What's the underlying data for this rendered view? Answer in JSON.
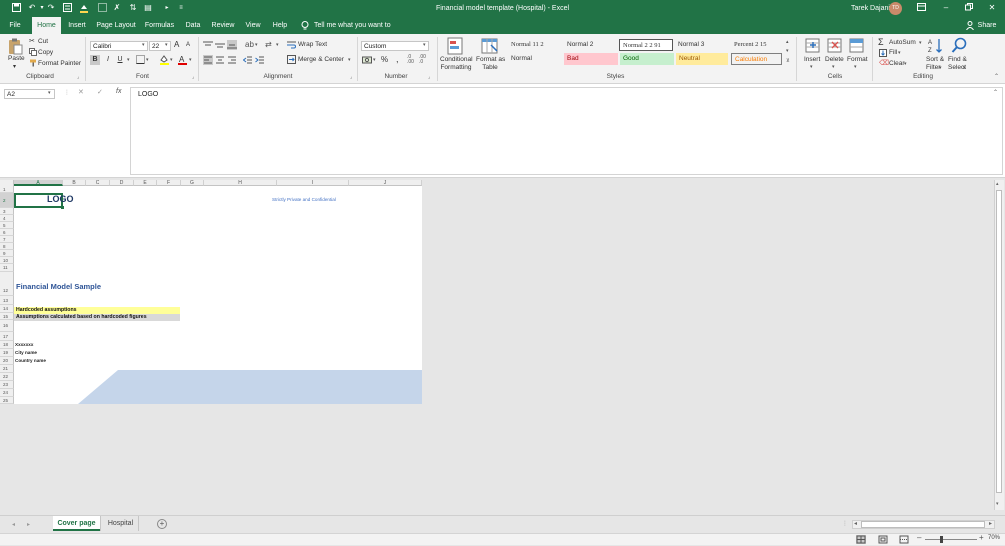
{
  "titlebar": {
    "title": "Financial model template (Hospital)  -  Excel",
    "user": "Tarek Dajani",
    "avatar_initials": "TD"
  },
  "ribbon_tabs": [
    "File",
    "Home",
    "Insert",
    "Page Layout",
    "Formulas",
    "Data",
    "Review",
    "View",
    "Help"
  ],
  "tell_me": "Tell me what you want to do",
  "share_label": "Share",
  "clipboard": {
    "paste": "Paste",
    "cut": "Cut",
    "copy": "Copy",
    "format_painter": "Format Painter",
    "label": "Clipboard"
  },
  "font": {
    "name": "Calibri",
    "size": "22",
    "bold": "B",
    "italic": "I",
    "underline": "U",
    "label": "Font"
  },
  "alignment": {
    "wrap_text": "Wrap Text",
    "merge_center": "Merge & Center",
    "label": "Alignment"
  },
  "number": {
    "format": "Custom",
    "percent": "%",
    "comma": ",",
    "label": "Number"
  },
  "styles": {
    "conditional_formatting": [
      "Conditional",
      "Formatting"
    ],
    "format_as_table": [
      "Format as",
      "Table"
    ],
    "gallery": [
      {
        "name": "Normal 11 2"
      },
      {
        "name": "Normal 2"
      },
      {
        "name": "Normal 2 2 91"
      },
      {
        "name": "Normal 3"
      },
      {
        "name": "Percent 2 15"
      },
      {
        "name": "Normal"
      },
      {
        "name": "Bad"
      },
      {
        "name": "Good"
      },
      {
        "name": "Neutral"
      },
      {
        "name": "Calculation"
      }
    ],
    "label": "Styles"
  },
  "cells": {
    "insert": "Insert",
    "delete": "Delete",
    "format": "Format",
    "label": "Cells"
  },
  "editing": {
    "autosum": "AutoSum",
    "fill": "Fill",
    "clear": "Clear",
    "sort_filter": [
      "Sort &",
      "Filter"
    ],
    "find_select": [
      "Find &",
      "Select"
    ],
    "label": "Editing"
  },
  "formula_bar": {
    "name_box": "A2",
    "cancel": "✕",
    "enter": "✓",
    "fx": "fx",
    "content": "LOGO"
  },
  "columns": [
    "A",
    "B",
    "C",
    "D",
    "E",
    "F",
    "G",
    "H",
    "I",
    "J"
  ],
  "rows": [
    "1",
    "2",
    "3",
    "4",
    "5",
    "6",
    "7",
    "8",
    "9",
    "10",
    "11",
    "12",
    "13",
    "14",
    "15",
    "16",
    "17",
    "18",
    "19",
    "20",
    "21",
    "22",
    "23",
    "24",
    "25"
  ],
  "sheet": {
    "logo": "LOGO",
    "confidential": "Strictly Private and Confidential",
    "title": "Financial Model Sample",
    "legend_hardcoded": "Hardcoded assumptions",
    "legend_calculated": "Assumptions calculated based on hardcoded figures",
    "client": "Xxxxxxx",
    "city": "City name",
    "country": "Country name"
  },
  "sheet_tabs": [
    {
      "label": "Cover page",
      "active": true
    },
    {
      "label": "Hospital",
      "active": false
    }
  ],
  "add_sheet": "+",
  "status": {
    "zoom": "70%"
  },
  "colors": {
    "excel_green": "#217346",
    "hardcoded_fill": "#ffff99",
    "calculated_fill": "#d9d9d9",
    "title_blue": "#2f5597",
    "band_blue": "#c5d5ea"
  }
}
